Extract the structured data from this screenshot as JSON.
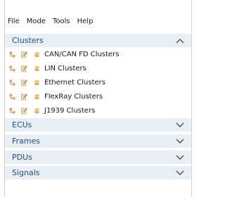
{
  "menu": [
    "File",
    "Mode",
    "Tools",
    "Help"
  ],
  "sections": {
    "clusters": {
      "label": "Clusters",
      "state": "expanded"
    },
    "ecus": {
      "label": "ECUs",
      "state": "collapsed"
    },
    "frames": {
      "label": "Frames",
      "state": "collapsed"
    },
    "pdus": {
      "label": "PDUs",
      "state": "collapsed"
    },
    "signals": {
      "label": "Signals",
      "state": "collapsed"
    }
  },
  "cluster_items": [
    "CAN/CAN FD Clusters",
    "LIN Clusters",
    "Ethernet Clusters",
    "FlexRay Clusters",
    "J1939 Clusters"
  ],
  "icons": {
    "row_icons": [
      "network-icon",
      "edit-icon",
      "database-icon"
    ],
    "chevron_expanded": "chevron-up-icon",
    "chevron_collapsed": "chevron-down-icon"
  },
  "colors": {
    "section_bg": "#e8eff7",
    "section_text": "#1e4d86",
    "network_icon": "#e0a06a",
    "edit_icon": "#d8b86a",
    "database_icon": "#d9a94d"
  }
}
